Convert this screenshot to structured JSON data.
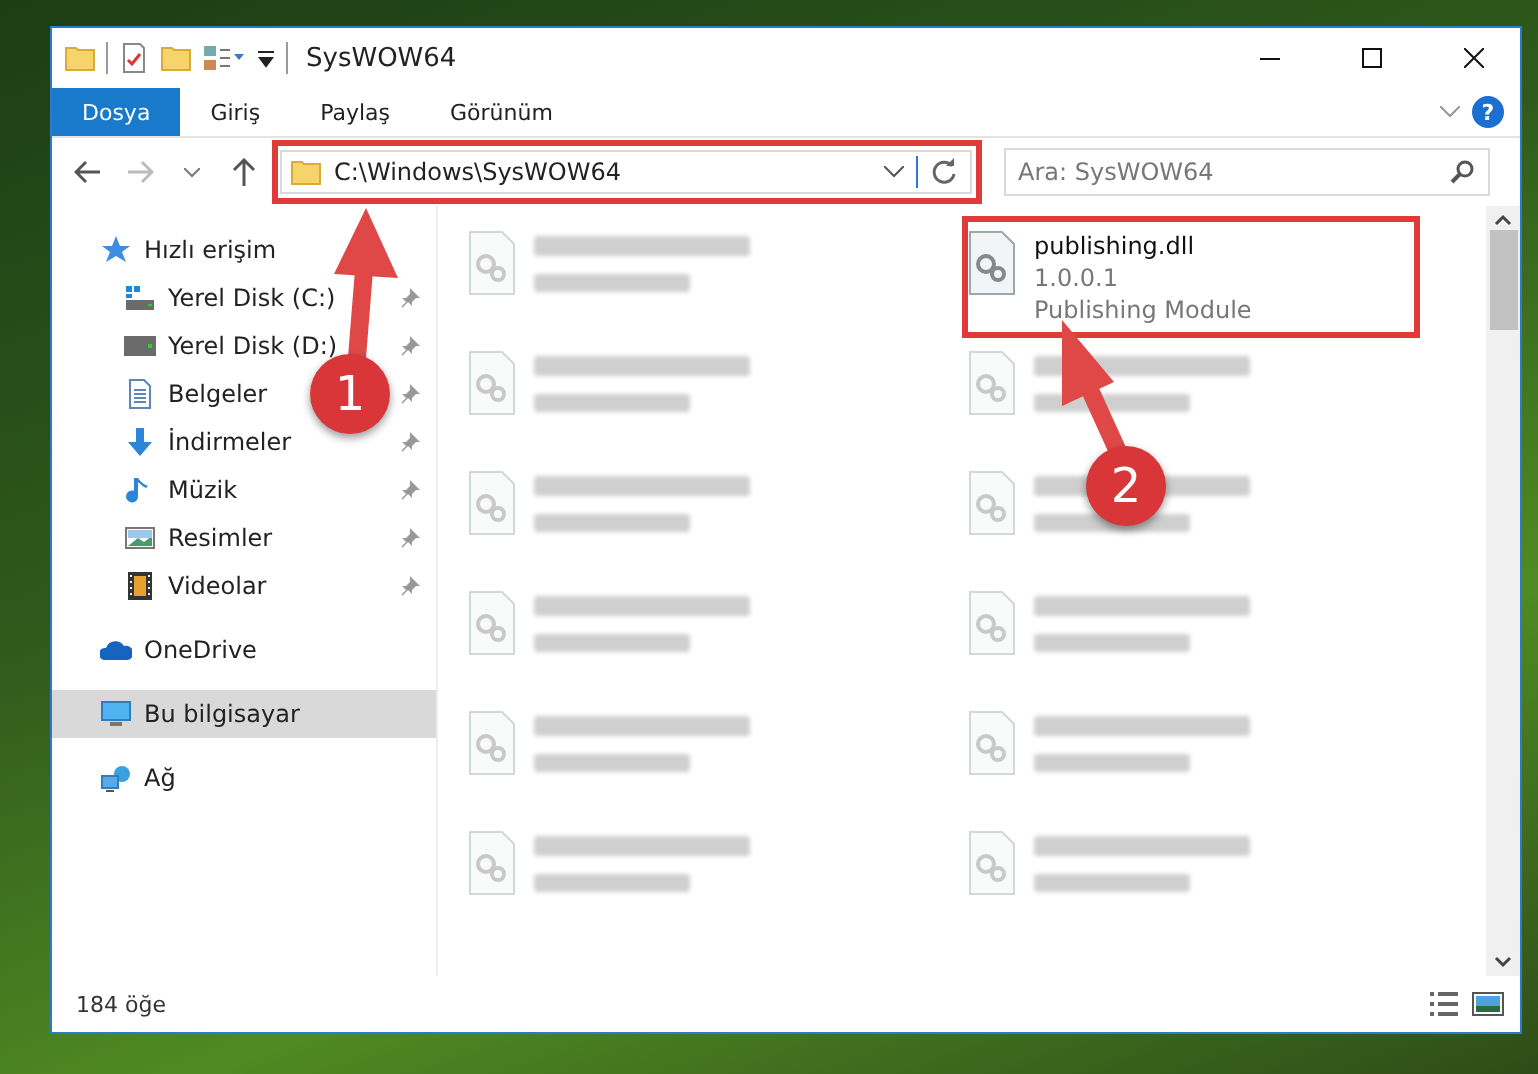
{
  "window": {
    "title": "SysWOW64"
  },
  "ribbon": {
    "tabs": [
      {
        "label": "Dosya",
        "selected": true
      },
      {
        "label": "Giriş",
        "selected": false
      },
      {
        "label": "Paylaş",
        "selected": false
      },
      {
        "label": "Görünüm",
        "selected": false
      }
    ],
    "help": "?"
  },
  "address_bar": {
    "path": "C:\\Windows\\SysWOW64"
  },
  "search": {
    "placeholder": "Ara: SysWOW64"
  },
  "sidebar": {
    "items": [
      {
        "label": "Hızlı erişim",
        "kind": "star",
        "selected": false,
        "children": [
          {
            "label": "Yerel Disk (C:)",
            "kind": "windisk",
            "selected": false,
            "pinned": true
          },
          {
            "label": "Yerel Disk (D:)",
            "kind": "disk",
            "selected": false,
            "pinned": true
          },
          {
            "label": "Belgeler",
            "kind": "docs",
            "selected": false,
            "pinned": true
          },
          {
            "label": "İndirmeler",
            "kind": "download",
            "selected": false,
            "pinned": true
          },
          {
            "label": "Müzik",
            "kind": "music",
            "selected": false,
            "pinned": true
          },
          {
            "label": "Resimler",
            "kind": "pictures",
            "selected": false,
            "pinned": true
          },
          {
            "label": "Videolar",
            "kind": "videos",
            "selected": false,
            "pinned": true
          }
        ]
      },
      {
        "label": "OneDrive",
        "kind": "cloud",
        "selected": false
      },
      {
        "label": "Bu bilgisayar",
        "kind": "pc",
        "selected": true
      },
      {
        "label": "Ağ",
        "kind": "network",
        "selected": false
      }
    ]
  },
  "files": [
    {
      "blurred": true
    },
    {
      "name": "publishing.dll",
      "details": [
        "1.0.0.1",
        "Publishing Module"
      ],
      "blurred": false
    },
    {
      "blurred": true
    },
    {
      "blurred": true
    },
    {
      "blurred": true
    },
    {
      "blurred": true
    },
    {
      "blurred": true
    },
    {
      "blurred": true
    },
    {
      "blurred": true
    },
    {
      "blurred": true
    },
    {
      "blurred": true
    },
    {
      "blurred": true
    }
  ],
  "status_bar": {
    "count": "184 öğe"
  },
  "annotations": [
    {
      "number": "1"
    },
    {
      "number": "2"
    }
  ]
}
